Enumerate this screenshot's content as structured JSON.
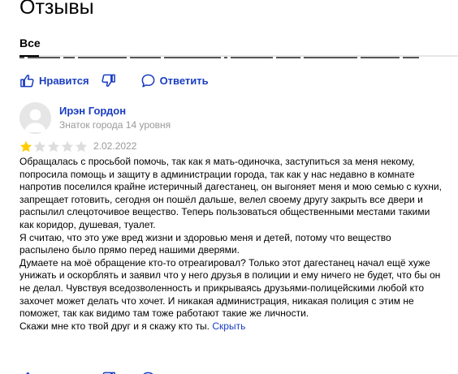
{
  "section": {
    "title": "Отзывы"
  },
  "filters": {
    "all_label": "Все"
  },
  "actions": {
    "like_label": "Нравится",
    "reply_label": "Ответить"
  },
  "review": {
    "author": "Ирэн Гордон",
    "author_level": "Знаток города 14 уровня",
    "rating": 1,
    "max_rating": 5,
    "date": "2.02.2022",
    "paragraphs": [
      "Обращалась с просьбой помочь, так как я мать-одиночка, заступиться за меня некому, попросила помощь и защиту в администрации города, так как у нас недавно в комнате напротив поселился крайне истеричный дагестанец, он выгоняет меня и мою семью с кухни, запрещает готовить, сегодня он пошёл дальше, велел своему другу закрыть все двери и распылил слецоточивое вещество. Теперь пользоваться общественными местами такими как коридор, душевая, туалет.",
      "Я считаю, что это уже вред жизни и здоровью меня и детей, потому что вещество распылено было прямо перед нашими дверями.",
      "Думаете на моё обращение кто-то отреагировал? Только этот дагестанец начал ещё хуже унижать и оскорблять и заявил что у него друзья в полиции и ему ничего не будет, что бы он не делал. Чувствуя вседозволенность и прикрываясь друзьями-полицейскими любой кто захочет может делать что хочет. И никакая администрация, никакая полиция с этим не поможет, так как видимо там тоже работают такие же личности."
    ],
    "last_line": "Скажи мне кто твой друг и я скажу кто ты.",
    "hide_label": "Скрыть"
  },
  "colors": {
    "link": "#1a3dc1",
    "star_filled": "#fc0",
    "star_empty": "#ddd",
    "muted": "#999"
  },
  "icons": {
    "like": "thumbs-up-icon",
    "dislike": "thumbs-down-icon",
    "reply": "speech-bubble-icon",
    "avatar": "default-user-avatar"
  }
}
